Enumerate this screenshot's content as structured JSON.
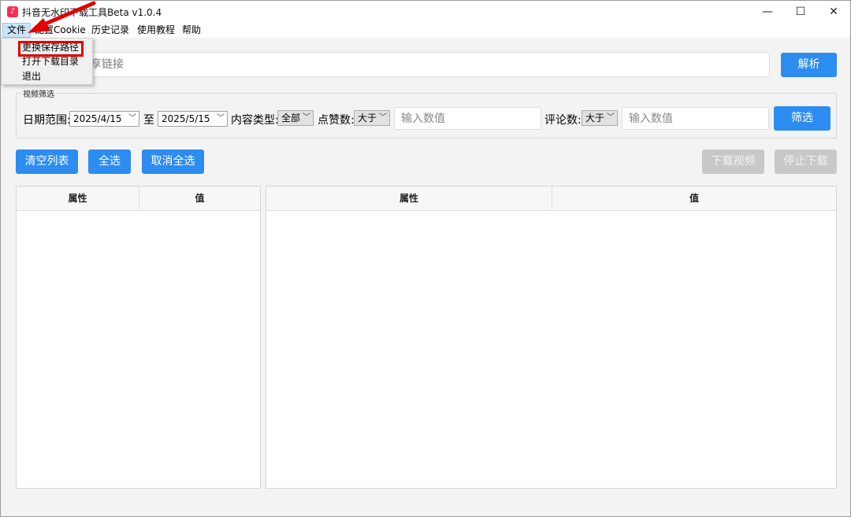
{
  "window": {
    "title": "抖音无水印下载工具Beta v1.0.4",
    "controls": {
      "minimize": "—",
      "maximize": "☐",
      "close": "✕"
    }
  },
  "menubar": {
    "items": [
      {
        "label": "文件"
      },
      {
        "label": "配置Cookie"
      },
      {
        "label": "历史记录"
      },
      {
        "label": "使用教程"
      },
      {
        "label": "帮助"
      }
    ]
  },
  "file_menu": {
    "items": [
      {
        "label": "更换保存路径"
      },
      {
        "label": "打开下载目录"
      },
      {
        "label": "退出"
      }
    ]
  },
  "url_bar": {
    "placeholder": "请粘贴抖音分享链接",
    "parse_button": "解析"
  },
  "filter": {
    "legend": "视频筛选",
    "date_range_label": "日期范围:",
    "date_start": "2025/4/15",
    "date_to_label": "至",
    "date_end": "2025/5/15",
    "content_type_label": "内容类型:",
    "content_type_value": "全部",
    "likes_label": "点赞数:",
    "likes_operator": "大于",
    "likes_placeholder": "输入数值",
    "comments_label": "评论数:",
    "comments_operator": "大于",
    "comments_placeholder": "输入数值",
    "filter_button": "筛选"
  },
  "actions": {
    "clear_list": "清空列表",
    "select_all": "全选",
    "deselect_all": "取消全选",
    "download_video": "下载视频",
    "stop_download": "停止下载"
  },
  "left_table": {
    "columns": [
      "属性",
      "值"
    ]
  },
  "right_table": {
    "columns": [
      "属性",
      "值"
    ]
  },
  "colors": {
    "primary": "#2d8cf0",
    "disabled": "#c8c8c8",
    "annotation": "#e00000"
  }
}
